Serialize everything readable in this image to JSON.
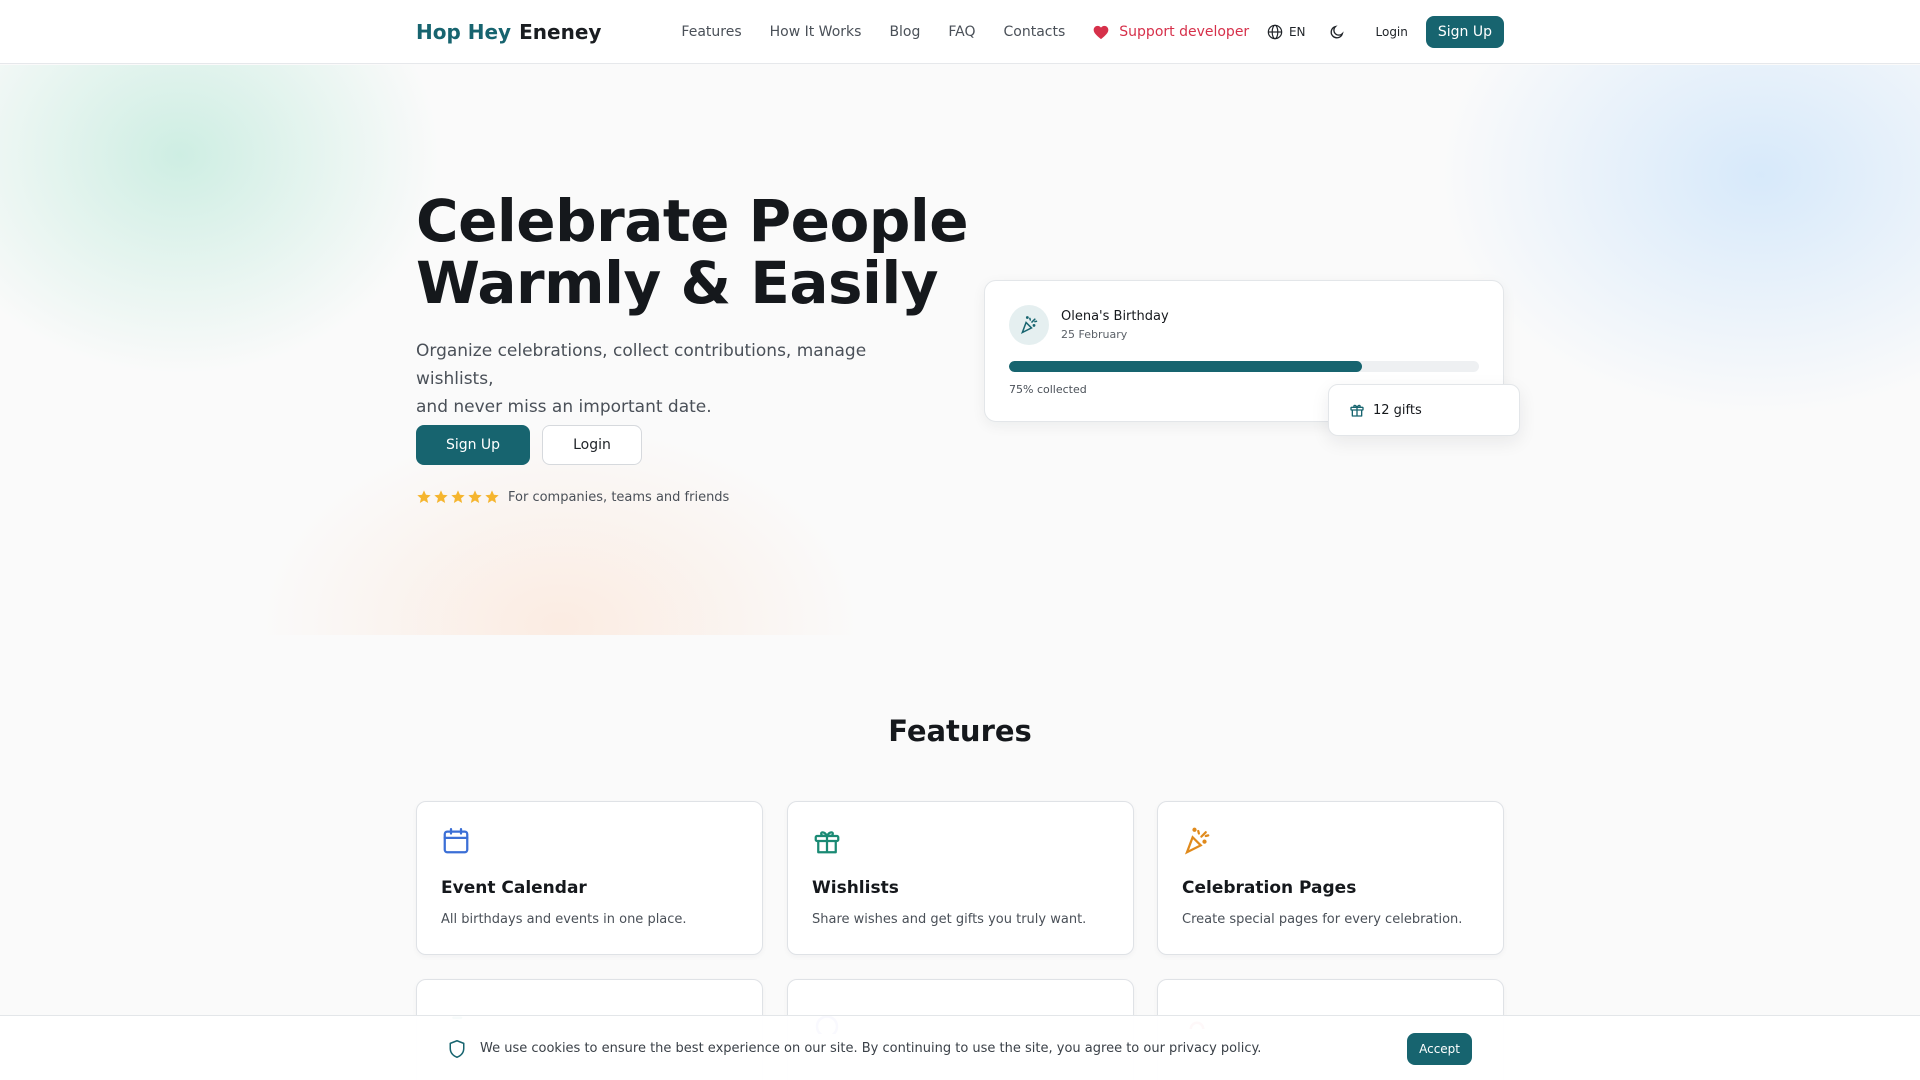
{
  "brand": {
    "part1": "Hop Hey",
    "part2": "Eneney"
  },
  "nav": {
    "links": [
      "Features",
      "How It Works",
      "Blog",
      "FAQ",
      "Contacts"
    ],
    "support": "Support developer",
    "language": "EN",
    "login": "Login",
    "signup": "Sign Up"
  },
  "hero": {
    "title_line1": "Celebrate People",
    "title_line2": "Warmly & Easily",
    "subtitle_line1": "Organize celebrations, collect contributions, manage wishlists,",
    "subtitle_line2": "and never miss an important date.",
    "signup": "Sign Up",
    "login": "Login",
    "rating_text": "For companies, teams and friends",
    "star_count": 5
  },
  "event_card": {
    "name": "Olena's Birthday",
    "date": "25 February",
    "progress_percent": 75,
    "progress_label": "75% collected",
    "gifts_label": "12 gifts"
  },
  "features": {
    "title": "Features",
    "items": [
      {
        "title": "Event Calendar",
        "desc": "All birthdays and events in one place.",
        "icon": "calendar-icon",
        "color": "#3b6fd6"
      },
      {
        "title": "Wishlists",
        "desc": "Share wishes and get gifts you truly want.",
        "icon": "gift-icon",
        "color": "#1a8a74"
      },
      {
        "title": "Celebration Pages",
        "desc": "Create special pages for every celebration.",
        "icon": "party-popper-icon",
        "color": "#e08a1c"
      }
    ]
  },
  "cookie": {
    "text": "We use cookies to ensure the best experience on our site. By continuing to use the site, you agree to our privacy policy.",
    "accept": "Accept"
  },
  "colors": {
    "primary": "#17646f",
    "support": "#d6304a",
    "star": "#f5b52e"
  }
}
